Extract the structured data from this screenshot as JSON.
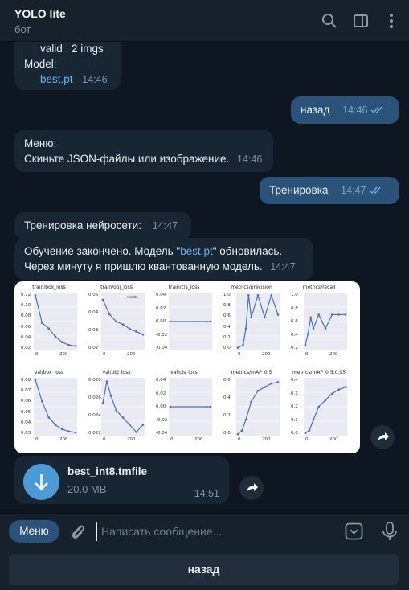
{
  "header": {
    "title": "YOLO lite",
    "subtitle": "бот",
    "icons": [
      "search-icon",
      "sidebar-toggle-icon",
      "more-vert-icon"
    ]
  },
  "messages": {
    "m1": {
      "line1": "valid : 2 imgs",
      "line2": "Model:",
      "link": "best.pt",
      "time": "14:46"
    },
    "m2": {
      "text": "назад",
      "time": "14:46"
    },
    "m3": {
      "line1": "Меню:",
      "line2": "Скиньте JSON-файлы или изображение.",
      "time": "14:46"
    },
    "m4": {
      "text": "Тренировка",
      "time": "14:47"
    },
    "m5": {
      "text": "Тренировка нейросети:",
      "time": "14:47"
    },
    "m6": {
      "prefix": "Обучение закончено. Модель \"",
      "link": "best.pt",
      "suffix": "\" обновилась.",
      "line2": "Через минуту я пришлю квантованную модель.",
      "time": "14:47"
    }
  },
  "chart_data": [
    {
      "type": "line",
      "title": "train/box_loss",
      "x": [
        0,
        50,
        100,
        150,
        200,
        250,
        300
      ],
      "y": [
        0.12,
        0.07,
        0.06,
        0.045,
        0.035,
        0.03,
        0.028
      ],
      "yticks": [
        "0.12",
        "0.10",
        "0.08",
        "0.06",
        "0.04",
        "0.02"
      ],
      "xticks": [
        "0",
        "200"
      ],
      "ylim": [
        0.02,
        0.125
      ]
    },
    {
      "type": "line",
      "title": "train/obj_loss",
      "legend": "results",
      "x": [
        0,
        50,
        100,
        150,
        200,
        250,
        300
      ],
      "y": [
        0.05,
        0.04,
        0.035,
        0.033,
        0.03,
        0.028,
        0.026
      ],
      "yticks": [
        "0.05",
        "0.04",
        "0.03",
        "0.02"
      ],
      "xticks": [
        "0",
        "200"
      ],
      "ylim": [
        0.015,
        0.055
      ]
    },
    {
      "type": "line",
      "title": "train/cls_loss",
      "x": [
        0,
        300
      ],
      "y": [
        0,
        0
      ],
      "yticks": [
        "0.04",
        "0.02",
        "0.00",
        "-0.02",
        "-0.04"
      ],
      "xticks": [],
      "ylim": [
        -0.05,
        0.05
      ]
    },
    {
      "type": "line",
      "title": "metrics/precision",
      "x": [
        0,
        40,
        60,
        80,
        100,
        150,
        200,
        250,
        300
      ],
      "y": [
        0.05,
        0.1,
        0.4,
        1.0,
        0.6,
        1.0,
        0.6,
        1.0,
        0.65
      ],
      "yticks": [
        "1.0",
        "0.8",
        "0.6",
        "0.4",
        "0.2",
        "0.0"
      ],
      "xticks": [
        "0",
        "200"
      ],
      "ylim": [
        0,
        1.05
      ]
    },
    {
      "type": "line",
      "title": "metrics/recall",
      "x": [
        0,
        20,
        40,
        60,
        100,
        150,
        200,
        250,
        300
      ],
      "y": [
        0.1,
        0.3,
        0.6,
        0.4,
        0.65,
        0.4,
        0.65,
        0.65,
        0.65
      ],
      "yticks": [
        "1.0",
        "0.8",
        "0.6",
        "0.4",
        "0.2"
      ],
      "xticks": [
        "0",
        "200"
      ],
      "ylim": [
        0,
        1.05
      ]
    },
    {
      "type": "line",
      "title": "val/box_loss",
      "x": [
        0,
        50,
        100,
        150,
        200,
        250,
        300
      ],
      "y": [
        0.08,
        0.06,
        0.045,
        0.038,
        0.034,
        0.032,
        0.031
      ],
      "yticks": [
        "0.08",
        "0.07",
        "0.06",
        "0.05",
        "0.04",
        "0.03"
      ],
      "xticks": [
        "0",
        "200"
      ],
      "ylim": [
        0.028,
        0.082
      ]
    },
    {
      "type": "line",
      "title": "val/obj_loss",
      "x": [
        0,
        30,
        60,
        100,
        150,
        200,
        250,
        300
      ],
      "y": [
        0.026,
        0.029,
        0.027,
        0.025,
        0.024,
        0.023,
        0.022,
        0.023
      ],
      "yticks": [
        "0.028",
        "0.026",
        "0.024",
        "0.022"
      ],
      "xticks": [
        "0",
        "200"
      ],
      "ylim": [
        0.0215,
        0.0295
      ]
    },
    {
      "type": "line",
      "title": "val/cls_loss",
      "x": [
        0,
        300
      ],
      "y": [
        0,
        0
      ],
      "yticks": [
        "0.04",
        "0.02",
        "0.00",
        "-0.02",
        "-0.04"
      ],
      "xticks": [
        "0",
        "200"
      ],
      "ylim": [
        -0.05,
        0.05
      ]
    },
    {
      "type": "line",
      "title": "metrics/mAP_0.5",
      "x": [
        0,
        30,
        60,
        100,
        150,
        200,
        250,
        300
      ],
      "y": [
        0.0,
        0.05,
        0.2,
        0.45,
        0.6,
        0.65,
        0.7,
        0.72
      ],
      "yticks": [
        "0.6",
        "0.4",
        "0.2",
        "0.0"
      ],
      "xticks": [
        "0",
        "200"
      ],
      "ylim": [
        -0.02,
        0.78
      ]
    },
    {
      "type": "line",
      "title": "metrics/mAP_0.5:0.95",
      "x": [
        0,
        30,
        60,
        100,
        150,
        200,
        250,
        300
      ],
      "y": [
        0.0,
        0.02,
        0.1,
        0.2,
        0.25,
        0.3,
        0.33,
        0.35
      ],
      "yticks": [
        "0.4",
        "0.3",
        "0.2",
        "0.1",
        "0.0"
      ],
      "xticks": [
        "0",
        "200"
      ],
      "ylim": [
        -0.02,
        0.42
      ]
    }
  ],
  "file": {
    "name": "best_int8.tmfile",
    "size": "20.0 MB",
    "time": "14:51"
  },
  "input": {
    "menu_label": "Меню",
    "placeholder": "Написать сообщение..."
  },
  "keyboard": {
    "button_label": "назад"
  },
  "colors": {
    "background": "#0e1621",
    "incoming": "#182533",
    "outgoing": "#2b5278",
    "accent": "#4e9ad7",
    "link": "#6ab3f3",
    "plot_line": "#4c72b0"
  }
}
